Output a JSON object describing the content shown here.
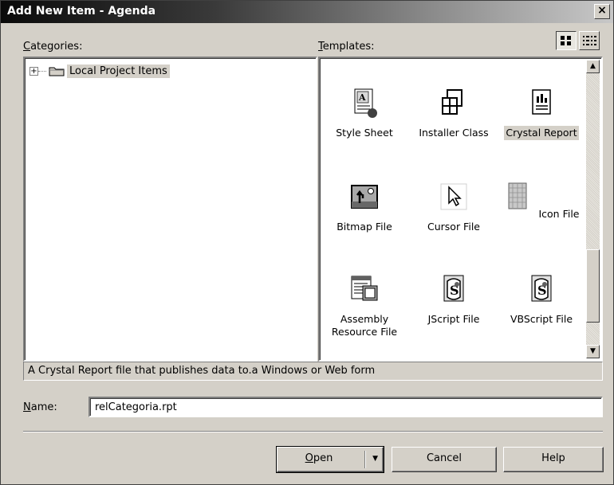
{
  "window": {
    "title": "Add New Item - Agenda",
    "close_label": "×"
  },
  "categories": {
    "label": "Categories:",
    "label_accel": "C",
    "label_rest": "ategories:",
    "tree": [
      {
        "label": "Local Project Items",
        "expander": "+"
      }
    ]
  },
  "templates": {
    "label_accel": "T",
    "label_rest": "emplates:",
    "view_large_icons": "large-icons-view",
    "view_small_icons": "small-icons-view",
    "items": [
      {
        "label": "Style Sheet",
        "icon": "style-sheet-icon"
      },
      {
        "label": "Installer Class",
        "icon": "installer-class-icon"
      },
      {
        "label": "Crystal Report",
        "icon": "crystal-report-icon",
        "selected": true
      },
      {
        "label": "Bitmap File",
        "icon": "bitmap-file-icon"
      },
      {
        "label": "Cursor File",
        "icon": "cursor-file-icon"
      },
      {
        "label": "Icon File",
        "icon": "icon-file-icon"
      },
      {
        "label": "Assembly Resource File",
        "icon": "assembly-resource-file-icon"
      },
      {
        "label": "JScript File",
        "icon": "jscript-file-icon"
      },
      {
        "label": "VBScript File",
        "icon": "vbscript-file-icon"
      }
    ]
  },
  "description": "A Crystal Report file that publishes data to.a Windows or Web form",
  "name_field": {
    "label_accel": "N",
    "label_rest": "ame:",
    "value": "relCategoria.rpt"
  },
  "buttons": {
    "open_accel": "O",
    "open_rest": "pen",
    "open_arrow": "▼",
    "cancel": "Cancel",
    "help": "Help"
  },
  "scrollbar": {
    "up": "▲",
    "down": "▼"
  }
}
